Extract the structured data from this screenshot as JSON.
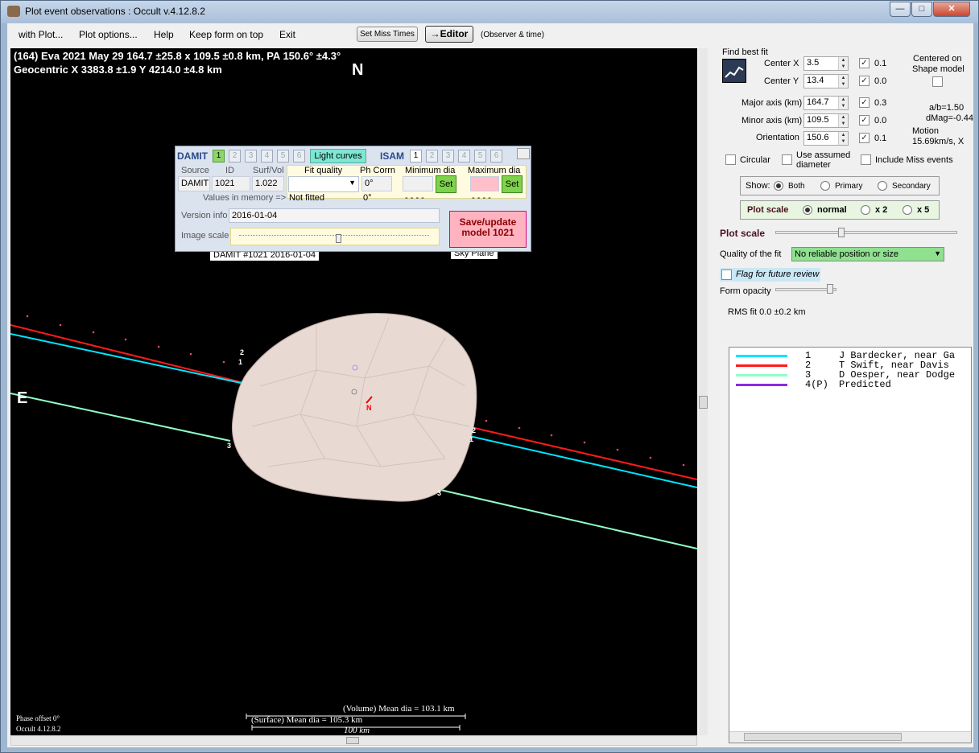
{
  "window": {
    "title": "Plot event observations : Occult v.4.12.8.2"
  },
  "menu": {
    "items": [
      "with Plot...",
      "Plot options...",
      "Help",
      "Keep form on top",
      "Exit"
    ],
    "set_miss_times": "Set Miss Times",
    "editor": "→Editor",
    "observer_time": "(Observer & time)"
  },
  "plot": {
    "header_line1": "(164) Eva  2021 May 29   164.7 ±25.8 x 109.5 ±0.8 km, PA 150.6° ±4.3°",
    "header_line2": "Geocentric  X  3383.8 ±1.9  Y 4214.0 ±4.8 km",
    "north": "N",
    "east": "E",
    "model_label": "DAMIT #1021 2016-01-04",
    "sky_plane": "Sky Plane",
    "phase_offset": "Phase offset 0°",
    "version": "Occult 4.12.8.2",
    "volume_dia": "(Volume) Mean dia = 103.1 km",
    "surface_dia": "(Surface) Mean dia = 105.3 km",
    "scale_bar": "100 km"
  },
  "damit": {
    "title": "DAMIT",
    "tabs": [
      "1",
      "2",
      "3",
      "4",
      "5",
      "6"
    ],
    "light_curves": "Light curves",
    "isam": "ISAM",
    "isam_tabs": [
      "1",
      "2",
      "3",
      "4",
      "5",
      "6"
    ],
    "col_source": "Source",
    "col_id": "ID",
    "col_surfvol": "Surf/Vol",
    "col_fit": "Fit quality",
    "col_phcorr": "Ph Corrn",
    "col_min": "Minimum dia",
    "col_max": "Maximum dia",
    "source": "DAMIT",
    "id": "1021",
    "surfvol": "1.022",
    "phcorr": "0°",
    "values_in_memory": "Values in memory =>",
    "not_fitted": "Not fitted",
    "phcorr_mem": "0°",
    "min_mem": "- - - -",
    "max_mem": "- - - -",
    "set1": "Set",
    "set2": "Set",
    "version_label": "Version info",
    "version_value": "2016-01-04",
    "image_scale": "Image scale",
    "save_button": "Save/update model 1021"
  },
  "fit": {
    "find_best": "Find best fit",
    "center_x_label": "Center X",
    "center_x": "3.5",
    "center_x_step": "0.1",
    "center_y_label": "Center Y",
    "center_y": "13.4",
    "center_y_step": "0.0",
    "major_label": "Major axis (km)",
    "major": "164.7",
    "major_step": "0.3",
    "minor_label": "Minor axis (km)",
    "minor": "109.5",
    "minor_step": "0.0",
    "orient_label": "Orientation",
    "orient": "150.6",
    "orient_step": "0.1",
    "centered_on": "Centered on",
    "shape_model": "Shape model",
    "ab": "a/b=1.50",
    "dmag": "dMag=-0.44",
    "motion": "Motion",
    "motion_val": "15.69km/s, X",
    "circular": "Circular",
    "use_assumed": "Use assumed",
    "diameter": "diameter",
    "include_miss": "Include Miss events",
    "show_label": "Show:",
    "show_both": "Both",
    "show_primary": "Primary",
    "show_secondary": "Secondary",
    "plot_scale": "Plot scale",
    "normal": "normal",
    "x2": "x 2",
    "x5": "x 5",
    "plot_scale2": "Plot scale",
    "quality_label": "Quality of the fit",
    "quality_value": "No reliable position or size",
    "flag": "Flag for future review",
    "form_opacity": "Form opacity",
    "rms": "RMS fit 0.0 ±0.2 km"
  },
  "legend": [
    {
      "num": "1",
      "name": "J Bardecker, near Ga",
      "color": "#00e5ff"
    },
    {
      "num": "2",
      "name": "T Swift, near Davis",
      "color": "#ff1a1a"
    },
    {
      "num": "3",
      "name": "D Oesper, near Dodge",
      "color": "#8fffc8"
    },
    {
      "num": "4(P)",
      "name": "Predicted",
      "color": "#8a2be2"
    }
  ]
}
